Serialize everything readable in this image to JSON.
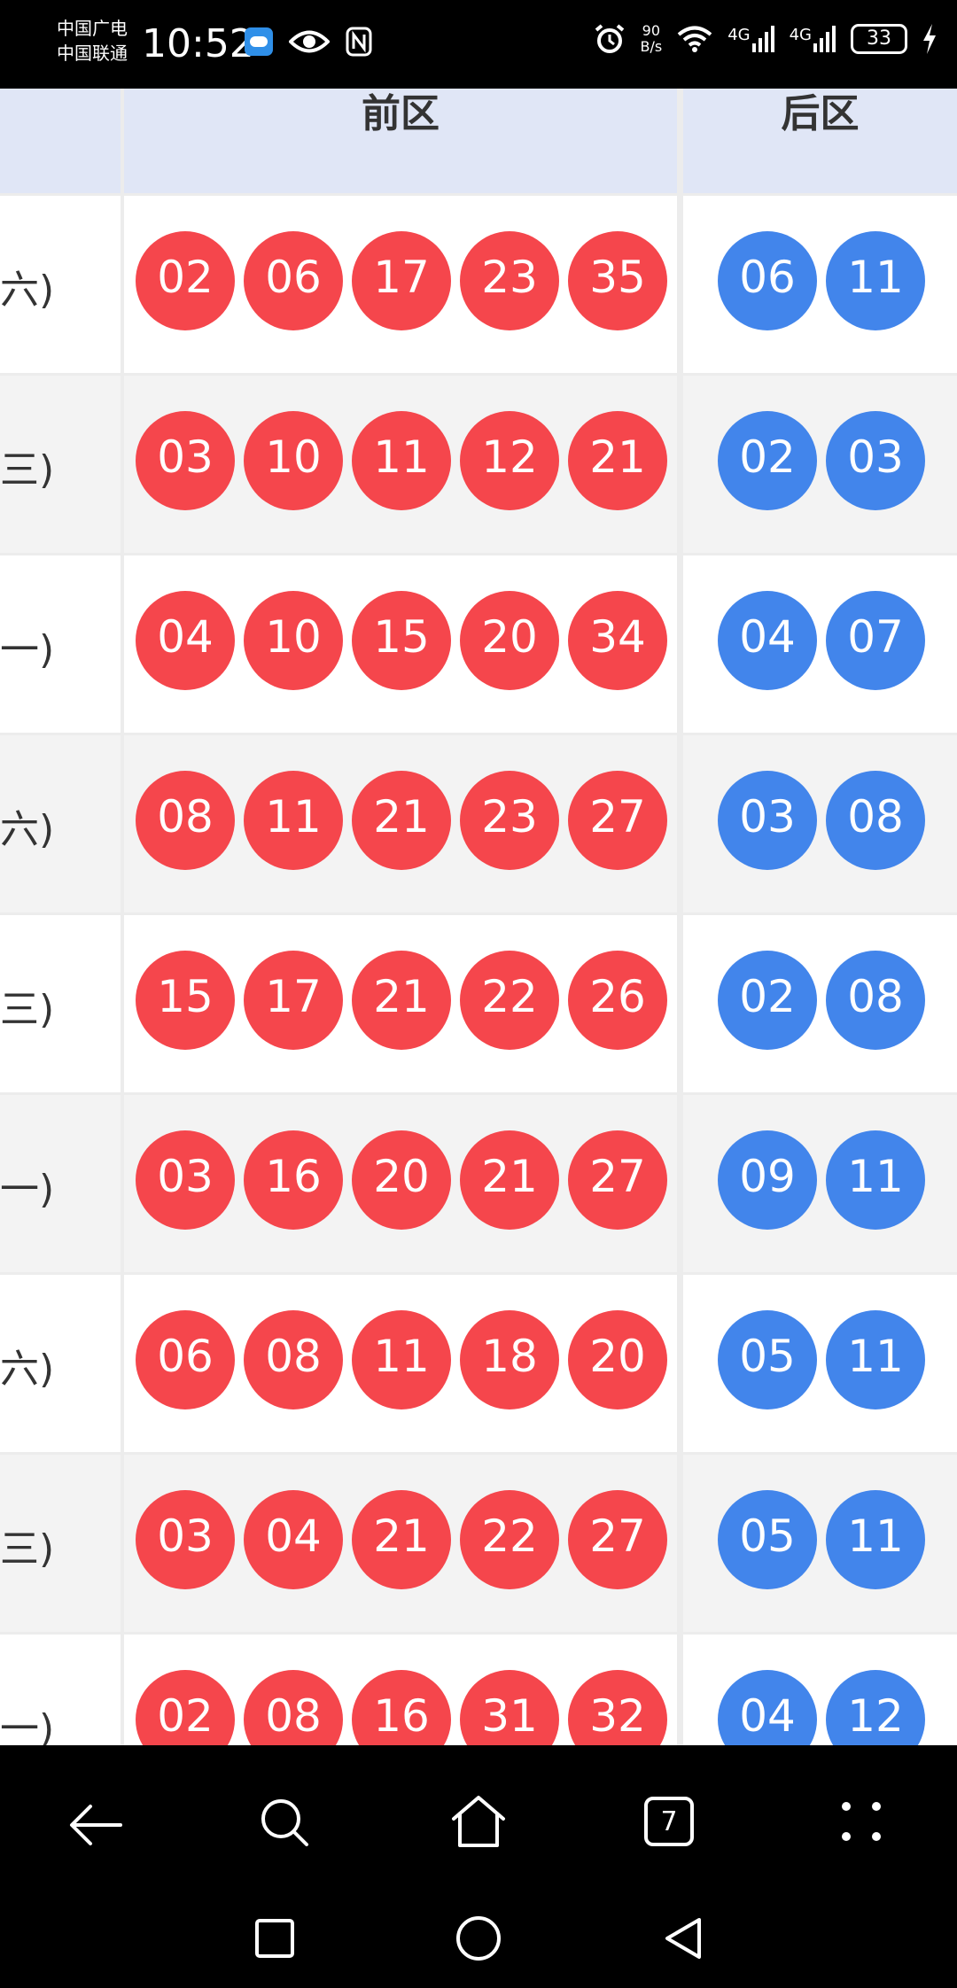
{
  "status_bar": {
    "carrier_1": "中国广电",
    "carrier_2": "中国联通",
    "time": "10:52",
    "net_speed_value": "90",
    "net_speed_unit": "B/s",
    "signal_1": "4G",
    "signal_2": "4G",
    "battery": "33"
  },
  "table": {
    "header_front": "前区",
    "header_back": "后区",
    "rows": [
      {
        "date": "六)",
        "front": [
          "02",
          "06",
          "17",
          "23",
          "35"
        ],
        "back": [
          "06",
          "11"
        ]
      },
      {
        "date": "三)",
        "front": [
          "03",
          "10",
          "11",
          "12",
          "21"
        ],
        "back": [
          "02",
          "03"
        ]
      },
      {
        "date": "一)",
        "front": [
          "04",
          "10",
          "15",
          "20",
          "34"
        ],
        "back": [
          "04",
          "07"
        ]
      },
      {
        "date": "六)",
        "front": [
          "08",
          "11",
          "21",
          "23",
          "27"
        ],
        "back": [
          "03",
          "08"
        ]
      },
      {
        "date": "三)",
        "front": [
          "15",
          "17",
          "21",
          "22",
          "26"
        ],
        "back": [
          "02",
          "08"
        ]
      },
      {
        "date": "一)",
        "front": [
          "03",
          "16",
          "20",
          "21",
          "27"
        ],
        "back": [
          "09",
          "11"
        ]
      },
      {
        "date": "六)",
        "front": [
          "06",
          "08",
          "11",
          "18",
          "20"
        ],
        "back": [
          "05",
          "11"
        ]
      },
      {
        "date": "三)",
        "front": [
          "03",
          "04",
          "21",
          "22",
          "27"
        ],
        "back": [
          "05",
          "11"
        ]
      },
      {
        "date": "一)",
        "front": [
          "02",
          "08",
          "16",
          "31",
          "32"
        ],
        "back": [
          "04",
          "12"
        ]
      }
    ]
  },
  "browser_nav": {
    "tab_count": "7"
  },
  "colors": {
    "front_ball": "#f5464c",
    "back_ball": "#4285eb",
    "header_bg": "#e0e6f6"
  }
}
